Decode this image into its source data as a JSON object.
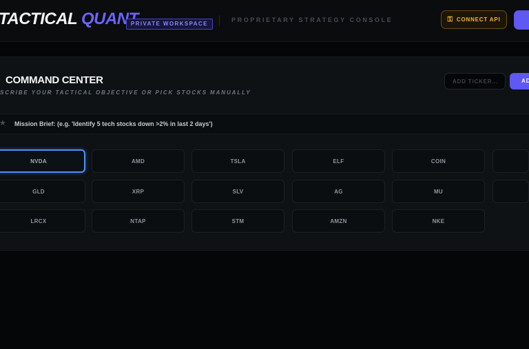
{
  "header": {
    "brand_part1": "TACTICAL",
    "brand_part2": "QUANT",
    "workspace_badge": "PRIVATE WORKSPACE",
    "console_label": "PROPRIETARY STRATEGY CONSOLE",
    "connect_label": "CONNECT API",
    "connect_icon": "key-icon",
    "accent_color": "#6d63ff",
    "warning_color": "#f2b233"
  },
  "command": {
    "title": "COMMAND CENTER",
    "subtitle": "SCRIBE YOUR TACTICAL OBJECTIVE OR PICK STOCKS MANUALLY",
    "ticker_placeholder": "ADD TICKER...",
    "add_label": "AD",
    "brief_icon": "star-icon",
    "brief_text": "Mission Brief: (e.g. 'Identify 5 tech stocks down >2% in last 2 days')"
  },
  "tickers": [
    [
      "NVDA",
      "AMD",
      "TSLA",
      "ELF",
      "COIN",
      ""
    ],
    [
      "GLD",
      "XRP",
      "SLV",
      "AG",
      "MU",
      ""
    ],
    [
      "LRCX",
      "NTAP",
      "STM",
      "AMZN",
      "NKE"
    ]
  ],
  "selected_ticker": "NVDA"
}
